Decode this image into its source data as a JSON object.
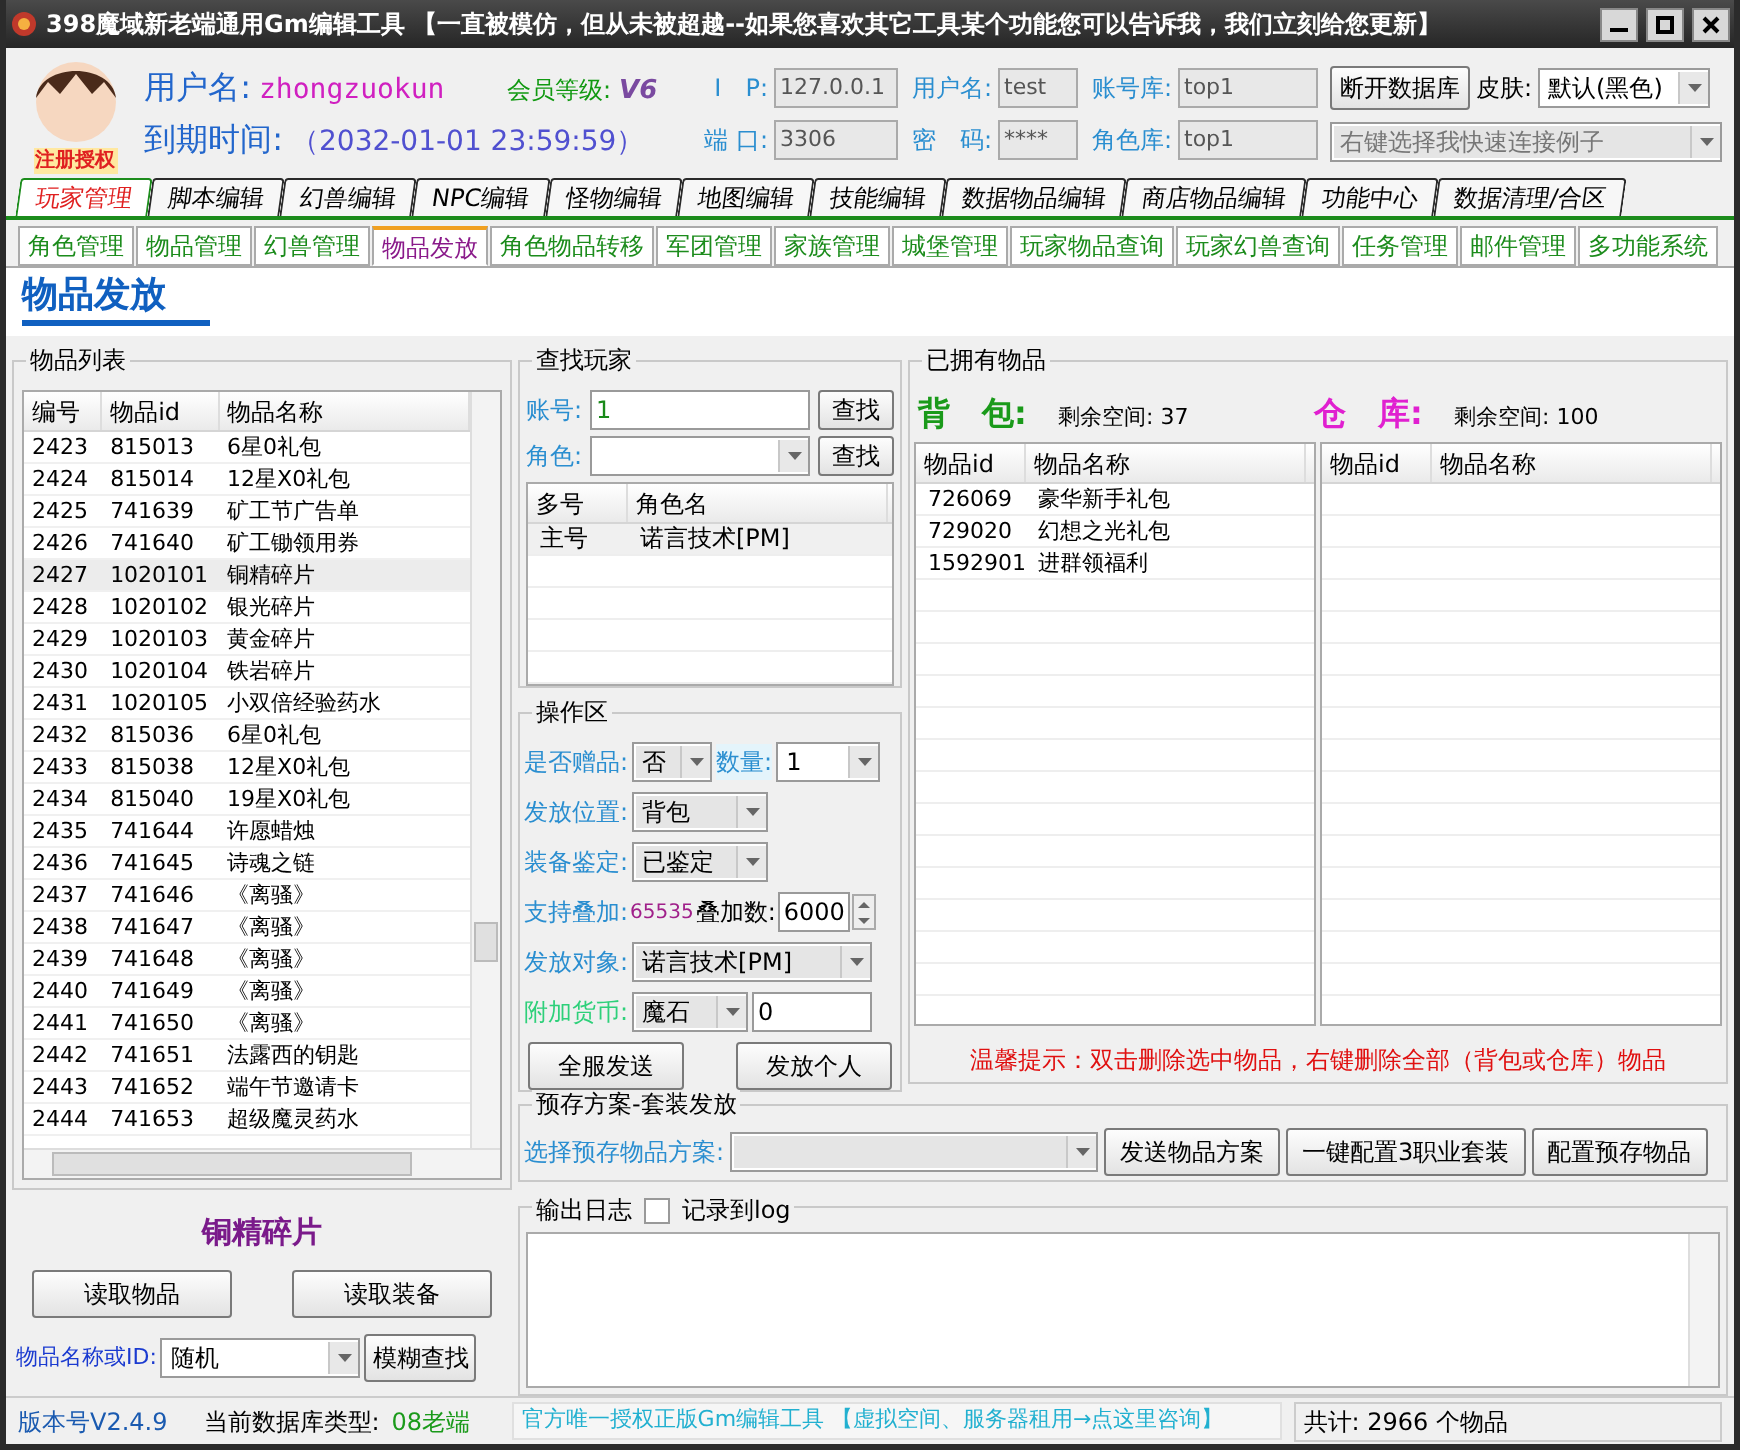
{
  "window": {
    "title": "398魔域新老端通用Gm编辑工具 【一直被模仿，但从未被超越--如果您喜欢其它工具某个功能您可以告诉我，我们立刻给您更新】"
  },
  "header": {
    "badge": "注册授权",
    "user_label": "用户名:",
    "user": "zhongzuokun",
    "level_label": "会员等级:",
    "level": "V6",
    "expiry_label": "到期时间:",
    "expiry": "（2032-01-01 23:59:59）",
    "ip_label": "I　P:",
    "ip": "127.0.0.1",
    "db_user_label": "用户名:",
    "db_user": "test",
    "account_db_label": "账号库:",
    "account_db": "top1",
    "port_label": "端 口:",
    "port": "3306",
    "pwd_label": "密　码:",
    "pwd": "****",
    "role_db_label": "角色库:",
    "role_db": "top1",
    "disconnect_button": "断开数据库",
    "skin_label": "皮肤:",
    "skin": "默认(黑色)",
    "connect_example": "右键选择我快速连接例子"
  },
  "tabs": [
    {
      "label": "玩家管理",
      "selected": true
    },
    {
      "label": "脚本编辑",
      "selected": false
    },
    {
      "label": "幻兽编辑",
      "selected": false
    },
    {
      "label": "NPC编辑",
      "selected": false
    },
    {
      "label": "怪物编辑",
      "selected": false
    },
    {
      "label": "地图编辑",
      "selected": false
    },
    {
      "label": "技能编辑",
      "selected": false
    },
    {
      "label": "数据物品编辑",
      "selected": false
    },
    {
      "label": "商店物品编辑",
      "selected": false
    },
    {
      "label": "功能中心",
      "selected": false
    },
    {
      "label": "数据清理/合区",
      "selected": false
    }
  ],
  "subtabs": [
    {
      "label": "角色管理",
      "selected": false
    },
    {
      "label": "物品管理",
      "selected": false
    },
    {
      "label": "幻兽管理",
      "selected": false
    },
    {
      "label": "物品发放",
      "selected": true
    },
    {
      "label": "角色物品转移",
      "selected": false
    },
    {
      "label": "军团管理",
      "selected": false
    },
    {
      "label": "家族管理",
      "selected": false
    },
    {
      "label": "城堡管理",
      "selected": false
    },
    {
      "label": "玩家物品查询",
      "selected": false
    },
    {
      "label": "玩家幻兽查询",
      "selected": false
    },
    {
      "label": "任务管理",
      "selected": false
    },
    {
      "label": "邮件管理",
      "selected": false
    },
    {
      "label": "多功能系统",
      "selected": false
    }
  ],
  "page_title": "物品发放",
  "item_list": {
    "title": "物品列表",
    "columns": [
      "编号",
      "物品id",
      "物品名称"
    ],
    "rows": [
      {
        "cells": [
          "2423",
          "815013",
          "6星0礼包"
        ],
        "selected": false
      },
      {
        "cells": [
          "2424",
          "815014",
          "12星X0礼包"
        ],
        "selected": false
      },
      {
        "cells": [
          "2425",
          "741639",
          "矿工节广告单"
        ],
        "selected": false
      },
      {
        "cells": [
          "2426",
          "741640",
          "矿工锄领用券"
        ],
        "selected": false
      },
      {
        "cells": [
          "2427",
          "1020101",
          "铜精碎片"
        ],
        "selected": true
      },
      {
        "cells": [
          "2428",
          "1020102",
          "银光碎片"
        ],
        "selected": false
      },
      {
        "cells": [
          "2429",
          "1020103",
          "黄金碎片"
        ],
        "selected": false
      },
      {
        "cells": [
          "2430",
          "1020104",
          "铁岩碎片"
        ],
        "selected": false
      },
      {
        "cells": [
          "2431",
          "1020105",
          "小双倍经验药水"
        ],
        "selected": false
      },
      {
        "cells": [
          "2432",
          "815036",
          "6星0礼包"
        ],
        "selected": false
      },
      {
        "cells": [
          "2433",
          "815038",
          "12星X0礼包"
        ],
        "selected": false
      },
      {
        "cells": [
          "2434",
          "815040",
          "19星X0礼包"
        ],
        "selected": false
      },
      {
        "cells": [
          "2435",
          "741644",
          "许愿蜡烛"
        ],
        "selected": false
      },
      {
        "cells": [
          "2436",
          "741645",
          "诗魂之链"
        ],
        "selected": false
      },
      {
        "cells": [
          "2437",
          "741646",
          "《离骚》"
        ],
        "selected": false
      },
      {
        "cells": [
          "2438",
          "741647",
          "《离骚》"
        ],
        "selected": false
      },
      {
        "cells": [
          "2439",
          "741648",
          "《离骚》"
        ],
        "selected": false
      },
      {
        "cells": [
          "2440",
          "741649",
          "《离骚》"
        ],
        "selected": false
      },
      {
        "cells": [
          "2441",
          "741650",
          "《离骚》"
        ],
        "selected": false
      },
      {
        "cells": [
          "2442",
          "741651",
          "法露西的钥匙"
        ],
        "selected": false
      },
      {
        "cells": [
          "2443",
          "741652",
          "端午节邀请卡"
        ],
        "selected": false
      },
      {
        "cells": [
          "2444",
          "741653",
          "超级魔灵药水"
        ],
        "selected": false
      }
    ],
    "selected_name": "铜精碎片",
    "read_items_button": "读取物品",
    "read_equipment_button": "读取装备",
    "search_label": "物品名称或ID:",
    "search_value": "随机",
    "fuzzy_button": "模糊查找"
  },
  "find_player": {
    "title": "查找玩家",
    "account_label": "账号:",
    "account_value": "1",
    "role_label": "角色:",
    "find_button": "查找",
    "role_find_button": "查找",
    "columns": [
      "多号",
      "角色名"
    ],
    "rows": [
      [
        "主号",
        "诺言技术[PM]"
      ]
    ]
  },
  "ops": {
    "title": "操作区",
    "gift_label": "是否赠品:",
    "gift": "否",
    "qty_label": "数量:",
    "qty": "1",
    "position_label": "发放位置:",
    "position": "背包",
    "identify_label": "装备鉴定:",
    "identify": "已鉴定",
    "stack_label": "支持叠加:",
    "stack_max": "65535",
    "stack_count_label": "叠加数:",
    "stack_count": "6000",
    "target_label": "发放对象:",
    "target": "诺言技术[PM]",
    "currency_label": "附加货币:",
    "currency": "魔石",
    "currency_amount": "0",
    "send_all_button": "全服发送",
    "send_one_button": "发放个人"
  },
  "owned": {
    "title": "已拥有物品",
    "bag_label": "背　包:",
    "bag_space": "剩余空间: 37",
    "warehouse_label": "仓　库:",
    "warehouse_space": "剩余空间: 100",
    "bag_columns": [
      "物品id",
      "物品名称"
    ],
    "bag_rows": [
      [
        "726069",
        "豪华新手礼包"
      ],
      [
        "729020",
        "幻想之光礼包"
      ],
      [
        "1592901",
        "进群领福利"
      ]
    ],
    "warehouse_columns": [
      "物品id",
      "物品名称"
    ],
    "hint": "温馨提示：双击删除选中物品，右键删除全部（背包或仓库）物品"
  },
  "preset": {
    "title": "预存方案-套装发放",
    "label": "选择预存物品方案:",
    "buttons": [
      "发送物品方案",
      "一键配置3职业套装",
      "配置预存物品"
    ]
  },
  "log": {
    "title": "输出日志",
    "checkbox_label": "记录到log",
    "checked": false
  },
  "status": {
    "version": "版本号V2.4.9",
    "db_type_label": "当前数据库类型:",
    "db_type": "08老端",
    "ad": "官方唯一授权正版Gm编辑工具 【虚拟空间、服务器租用→点这里咨询】",
    "total": "共计: 2966 个物品"
  }
}
